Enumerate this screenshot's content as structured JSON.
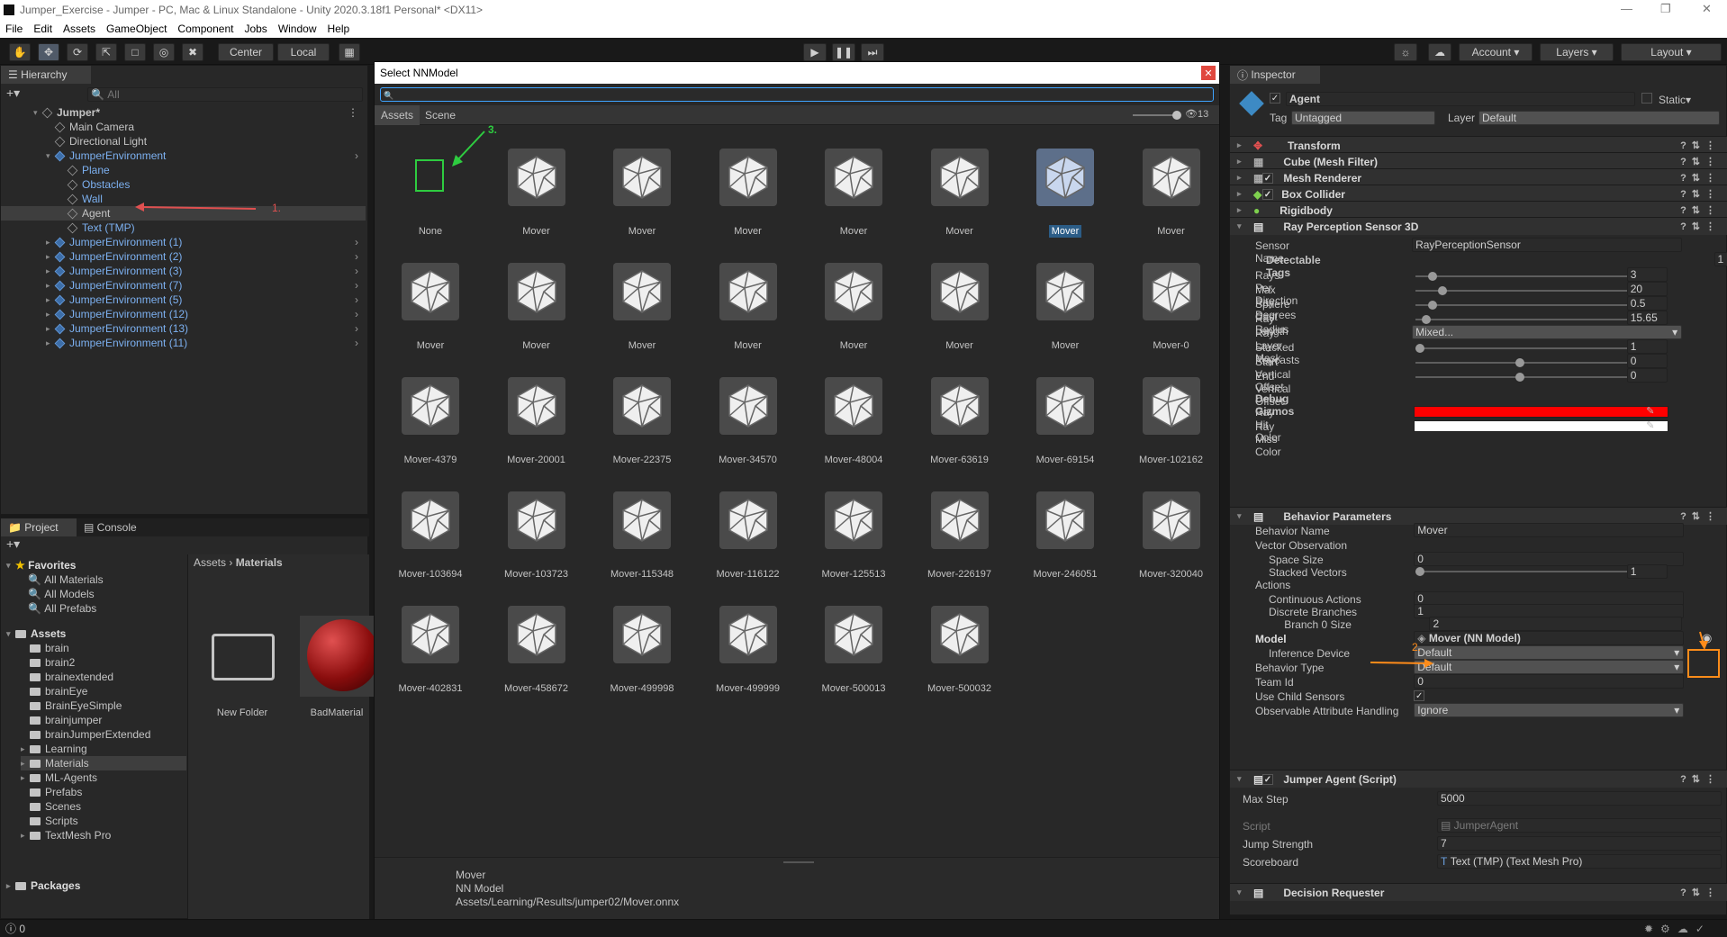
{
  "window": {
    "title": "Jumper_Exercise - Jumper - PC, Mac & Linux Standalone - Unity 2020.3.18f1 Personal* <DX11>"
  },
  "menu": [
    "File",
    "Edit",
    "Assets",
    "GameObject",
    "Component",
    "Jobs",
    "Window",
    "Help"
  ],
  "toolbar": {
    "center": "Center",
    "local": "Local",
    "account": "Account",
    "layers": "Layers",
    "layout": "Layout"
  },
  "hierarchy": {
    "tab": "Hierarchy",
    "search_placeholder": "All",
    "rows": [
      {
        "label": "Jumper*",
        "indent": 0,
        "kind": "scene"
      },
      {
        "label": "Main Camera",
        "indent": 1,
        "kind": "obj"
      },
      {
        "label": "Directional Light",
        "indent": 1,
        "kind": "obj"
      },
      {
        "label": "JumperEnvironment",
        "indent": 1,
        "kind": "prefab"
      },
      {
        "label": "Plane",
        "indent": 2,
        "kind": "prefabchild"
      },
      {
        "label": "Obstacles",
        "indent": 2,
        "kind": "prefabchild"
      },
      {
        "label": "Wall",
        "indent": 2,
        "kind": "prefabchild"
      },
      {
        "label": "Agent",
        "indent": 2,
        "kind": "selected"
      },
      {
        "label": "Text (TMP)",
        "indent": 2,
        "kind": "prefabchild"
      },
      {
        "label": "JumperEnvironment (1)",
        "indent": 1,
        "kind": "prefab"
      },
      {
        "label": "JumperEnvironment (2)",
        "indent": 1,
        "kind": "prefab"
      },
      {
        "label": "JumperEnvironment (3)",
        "indent": 1,
        "kind": "prefab"
      },
      {
        "label": "JumperEnvironment (7)",
        "indent": 1,
        "kind": "prefab"
      },
      {
        "label": "JumperEnvironment (5)",
        "indent": 1,
        "kind": "prefab"
      },
      {
        "label": "JumperEnvironment (12)",
        "indent": 1,
        "kind": "prefab"
      },
      {
        "label": "JumperEnvironment (13)",
        "indent": 1,
        "kind": "prefab"
      },
      {
        "label": "JumperEnvironment (11)",
        "indent": 1,
        "kind": "prefab"
      }
    ]
  },
  "project": {
    "tabs": [
      "Project",
      "Console"
    ],
    "favorites_label": "Favorites",
    "favorites": [
      "All Materials",
      "All Models",
      "All Prefabs"
    ],
    "assets_label": "Assets",
    "folders": [
      "brain",
      "brain2",
      "brainextended",
      "brainEye",
      "BrainEyeSimple",
      "brainjumper",
      "brainJumperExtended",
      "Learning",
      "Materials",
      "ML-Agents",
      "Prefabs",
      "Scenes",
      "Scripts",
      "TextMesh Pro"
    ],
    "packages_label": "Packages",
    "breadcrumb": [
      "Assets",
      "Materials"
    ],
    "items": [
      "New Folder",
      "BadMaterial"
    ]
  },
  "dialog": {
    "title": "Select NNModel",
    "tabs": [
      "Assets",
      "Scene"
    ],
    "count": "13",
    "items": [
      "None",
      "Mover",
      "Mover",
      "Mover",
      "Mover",
      "Mover",
      "Mover",
      "Mover",
      "Mover",
      "Mover",
      "Mover",
      "Mover",
      "Mover",
      "Mover",
      "Mover",
      "Mover-0",
      "Mover-4379",
      "Mover-20001",
      "Mover-22375",
      "Mover-34570",
      "Mover-48004",
      "Mover-63619",
      "Mover-69154",
      "Mover-102162",
      "Mover-103694",
      "Mover-103723",
      "Mover-115348",
      "Mover-116122",
      "Mover-125513",
      "Mover-226197",
      "Mover-246051",
      "Mover-320040",
      "Mover-402831",
      "Mover-458672",
      "Mover-499998",
      "Mover-499999",
      "Mover-500013",
      "Mover-500032"
    ],
    "selected_index": 6,
    "details": [
      "Mover",
      "NN Model",
      "Assets/Learning/Results/jumper02/Mover.onnx"
    ]
  },
  "inspector": {
    "tab": "Inspector",
    "object_name": "Agent",
    "static_label": "Static",
    "tag_label": "Tag",
    "tag_value": "Untagged",
    "layer_label": "Layer",
    "layer_value": "Default",
    "components": [
      "Transform",
      "Cube (Mesh Filter)",
      "Mesh Renderer",
      "Box Collider",
      "Rigidbody",
      "Ray Perception Sensor 3D"
    ],
    "ray": {
      "sensor_name_label": "Sensor Name",
      "sensor_name": "RayPerceptionSensor",
      "detectable_tags_label": "Detectable Tags",
      "detectable_tags": "1",
      "rays_label": "Rays Per Direction",
      "rays": "3",
      "max_deg_label": "Max Ray Degrees",
      "max_deg": "20",
      "sphere_label": "Sphere Cast Radius",
      "sphere": "0.5",
      "length_label": "Ray Length",
      "length": "15.65",
      "mask_label": "Ray Layer Mask",
      "mask": "Mixed...",
      "stacked_label": "Stacked Raycasts",
      "stacked": "1",
      "start_label": "Start Vertical Offset",
      "start": "0",
      "end_label": "End Vertical Offset",
      "end": "0",
      "debug_label": "Debug Gizmos",
      "hit_label": "Ray Hit Color",
      "hit_color": "#ff0000",
      "miss_label": "Ray Miss Color",
      "miss_color": "#ffffff"
    },
    "behavior": {
      "header": "Behavior Parameters",
      "name_label": "Behavior Name",
      "name": "Mover",
      "vector_label": "Vector Observation",
      "space_label": "Space Size",
      "space": "0",
      "stacked_label": "Stacked Vectors",
      "stacked": "1",
      "actions_label": "Actions",
      "cont_label": "Continuous Actions",
      "cont": "0",
      "disc_label": "Discrete Branches",
      "disc": "1",
      "branch_label": "Branch 0 Size",
      "branch": "2",
      "model_label": "Model",
      "model": "Mover (NN Model)",
      "device_label": "Inference Device",
      "device": "Default",
      "type_label": "Behavior Type",
      "type": "Default",
      "team_label": "Team Id",
      "team": "0",
      "child_label": "Use Child Sensors",
      "obs_label": "Observable Attribute Handling",
      "obs": "Ignore"
    },
    "jumper": {
      "header": "Jumper Agent (Script)",
      "max_step_label": "Max Step",
      "max_step": "5000",
      "script_label": "Script",
      "script": "JumperAgent",
      "jump_label": "Jump Strength",
      "jump": "7",
      "score_label": "Scoreboard",
      "score": "Text (TMP) (Text Mesh Pro)"
    },
    "decision_header": "Decision Requester"
  },
  "annotations": {
    "a1": "1.",
    "a2": "2.",
    "a3": "3."
  },
  "status": {
    "count": "0"
  }
}
